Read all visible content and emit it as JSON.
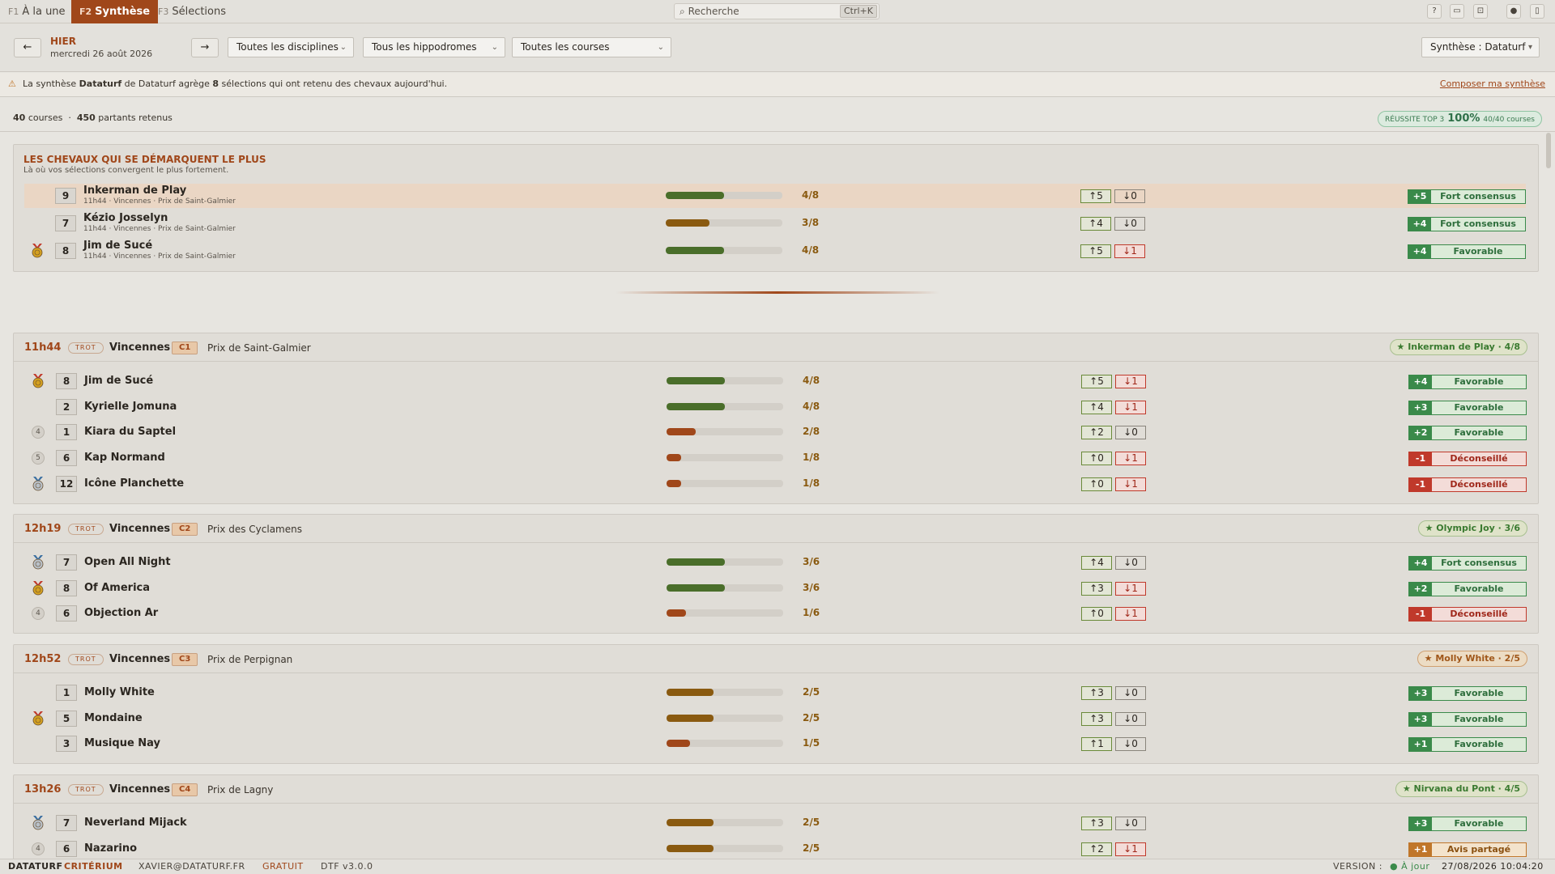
{
  "tabs": [
    {
      "key": "F1",
      "label": "À la une"
    },
    {
      "key": "F2",
      "label": "Synthèse"
    },
    {
      "key": "F3",
      "label": "Sélections"
    }
  ],
  "search": {
    "placeholder": "Recherche",
    "shortcut": "Ctrl+K"
  },
  "toolbar_icons": [
    "help-icon",
    "keyboard-icon",
    "window-icon",
    "user-icon",
    "panel-icon"
  ],
  "nav": {
    "prev": "←",
    "next": "→",
    "day": "HIER",
    "date": "mercredi 26 août 2026",
    "filters": [
      "Toutes les disciplines",
      "Tous les hippodromes",
      "Toutes les courses"
    ],
    "synthese": "Synthèse : Dataturf"
  },
  "info": {
    "icon": "⚠",
    "pre": "La synthèse ",
    "source": "Dataturf",
    "mid1": " de Dataturf agrège ",
    "count": "8",
    "mid2": " sélections qui ont retenu des chevaux aujourd'hui.",
    "link": "Composer ma synthèse"
  },
  "stats": {
    "courses": "40",
    "courses_label": "courses",
    "sep": "·",
    "partants": "450",
    "partants_label": "partants retenus",
    "reussite_label": "RÉUSSITE TOP 3",
    "reussite_pct": "100%",
    "reussite_detail": "40/40 courses"
  },
  "highlight": {
    "title": "LES CHEVAUX QUI SE DÉMARQUENT LE PLUS",
    "subtitle": "Là où vos sélections convergent le plus fortement.",
    "rows": [
      {
        "num": "9",
        "name": "Inkerman de Play",
        "meta": "11h44 · Vincennes · Prix de Saint-Galmier",
        "frac": "4/8",
        "ratio": 0.5,
        "color": "#4a6e2a",
        "up": "↑5",
        "down": "↓0",
        "down_neg": false,
        "score": "+5",
        "label": "Fort consensus",
        "tone": "pos",
        "medal": "",
        "rank": ""
      },
      {
        "num": "7",
        "name": "Kézio Josselyn",
        "meta": "11h44 · Vincennes · Prix de Saint-Galmier",
        "frac": "3/8",
        "ratio": 0.375,
        "color": "#8a5a10",
        "up": "↑4",
        "down": "↓0",
        "down_neg": false,
        "score": "+4",
        "label": "Fort consensus",
        "tone": "pos",
        "medal": "",
        "rank": ""
      },
      {
        "num": "8",
        "name": "Jim de Sucé",
        "meta": "11h44 · Vincennes · Prix de Saint-Galmier",
        "frac": "4/8",
        "ratio": 0.5,
        "color": "#4a6e2a",
        "up": "↑5",
        "down": "↓1",
        "down_neg": true,
        "score": "+4",
        "label": "Favorable",
        "tone": "pos",
        "medal": "gold",
        "rank": ""
      }
    ]
  },
  "races": [
    {
      "time": "11h44",
      "disc": "TROT",
      "venue": "Vincennes",
      "code": "C1",
      "prix": "Prix de Saint-Galmier",
      "star": "★ Inkerman de Play · 4/8",
      "star_tone": "green",
      "rows": [
        {
          "num": "8",
          "name": "Jim de Sucé",
          "frac": "4/8",
          "ratio": 0.5,
          "color": "#4a6e2a",
          "up": "↑5",
          "down": "↓1",
          "down_neg": true,
          "score": "+4",
          "label": "Favorable",
          "tone": "pos",
          "medal": "gold",
          "rank": ""
        },
        {
          "num": "2",
          "name": "Kyrielle Jomuna",
          "frac": "4/8",
          "ratio": 0.5,
          "color": "#4a6e2a",
          "up": "↑4",
          "down": "↓1",
          "down_neg": true,
          "score": "+3",
          "label": "Favorable",
          "tone": "pos",
          "medal": "",
          "rank": ""
        },
        {
          "num": "1",
          "name": "Kiara du Saptel",
          "frac": "2/8",
          "ratio": 0.25,
          "color": "#a0471a",
          "up": "↑2",
          "down": "↓0",
          "down_neg": false,
          "score": "+2",
          "label": "Favorable",
          "tone": "pos",
          "medal": "",
          "rank": "4"
        },
        {
          "num": "6",
          "name": "Kap Normand",
          "frac": "1/8",
          "ratio": 0.125,
          "color": "#a0471a",
          "up": "↑0",
          "down": "↓1",
          "down_neg": true,
          "score": "-1",
          "label": "Déconseillé",
          "tone": "neg",
          "medal": "",
          "rank": "5"
        },
        {
          "num": "12",
          "name": "Icône Planchette",
          "frac": "1/8",
          "ratio": 0.125,
          "color": "#a0471a",
          "up": "↑0",
          "down": "↓1",
          "down_neg": true,
          "score": "-1",
          "label": "Déconseillé",
          "tone": "neg",
          "medal": "silver",
          "rank": ""
        }
      ]
    },
    {
      "time": "12h19",
      "disc": "TROT",
      "venue": "Vincennes",
      "code": "C2",
      "prix": "Prix des Cyclamens",
      "star": "★ Olympic Joy · 3/6",
      "star_tone": "green",
      "rows": [
        {
          "num": "7",
          "name": "Open All Night",
          "frac": "3/6",
          "ratio": 0.5,
          "color": "#4a6e2a",
          "up": "↑4",
          "down": "↓0",
          "down_neg": false,
          "score": "+4",
          "label": "Fort consensus",
          "tone": "pos",
          "medal": "silver",
          "rank": ""
        },
        {
          "num": "8",
          "name": "Of America",
          "frac": "3/6",
          "ratio": 0.5,
          "color": "#4a6e2a",
          "up": "↑3",
          "down": "↓1",
          "down_neg": true,
          "score": "+2",
          "label": "Favorable",
          "tone": "pos",
          "medal": "gold",
          "rank": ""
        },
        {
          "num": "6",
          "name": "Objection Ar",
          "frac": "1/6",
          "ratio": 0.166,
          "color": "#a0471a",
          "up": "↑0",
          "down": "↓1",
          "down_neg": true,
          "score": "-1",
          "label": "Déconseillé",
          "tone": "neg",
          "medal": "",
          "rank": "4"
        }
      ]
    },
    {
      "time": "12h52",
      "disc": "TROT",
      "venue": "Vincennes",
      "code": "C3",
      "prix": "Prix de Perpignan",
      "star": "★ Molly White · 2/5",
      "star_tone": "orange",
      "rows": [
        {
          "num": "1",
          "name": "Molly White",
          "frac": "2/5",
          "ratio": 0.4,
          "color": "#8a5a10",
          "up": "↑3",
          "down": "↓0",
          "down_neg": false,
          "score": "+3",
          "label": "Favorable",
          "tone": "pos",
          "medal": "",
          "rank": ""
        },
        {
          "num": "5",
          "name": "Mondaine",
          "frac": "2/5",
          "ratio": 0.4,
          "color": "#8a5a10",
          "up": "↑3",
          "down": "↓0",
          "down_neg": false,
          "score": "+3",
          "label": "Favorable",
          "tone": "pos",
          "medal": "gold",
          "rank": ""
        },
        {
          "num": "3",
          "name": "Musique Nay",
          "frac": "1/5",
          "ratio": 0.2,
          "color": "#a0471a",
          "up": "↑1",
          "down": "↓0",
          "down_neg": false,
          "score": "+1",
          "label": "Favorable",
          "tone": "pos",
          "medal": "",
          "rank": ""
        }
      ]
    },
    {
      "time": "13h26",
      "disc": "TROT",
      "venue": "Vincennes",
      "code": "C4",
      "prix": "Prix de Lagny",
      "star": "★ Nirvana du Pont · 4/5",
      "star_tone": "green",
      "rows": [
        {
          "num": "7",
          "name": "Neverland Mijack",
          "frac": "2/5",
          "ratio": 0.4,
          "color": "#8a5a10",
          "up": "↑3",
          "down": "↓0",
          "down_neg": false,
          "score": "+3",
          "label": "Favorable",
          "tone": "pos",
          "medal": "silver",
          "rank": ""
        },
        {
          "num": "6",
          "name": "Nazarino",
          "frac": "2/5",
          "ratio": 0.4,
          "color": "#8a5a10",
          "up": "↑2",
          "down": "↓1",
          "down_neg": true,
          "score": "+1",
          "label": "Avis partagé",
          "tone": "mid",
          "medal": "",
          "rank": "4"
        }
      ]
    }
  ],
  "footer": {
    "brand": "DATATURF",
    "product": "CRITÉRIUM",
    "email": "XAVIER@DATATURF.FR",
    "plan": "GRATUIT",
    "version": "DTF v3.0.0",
    "version_label": "VERSION :",
    "status": "● À jour",
    "datetime": "27/08/2026 10:04:20"
  }
}
